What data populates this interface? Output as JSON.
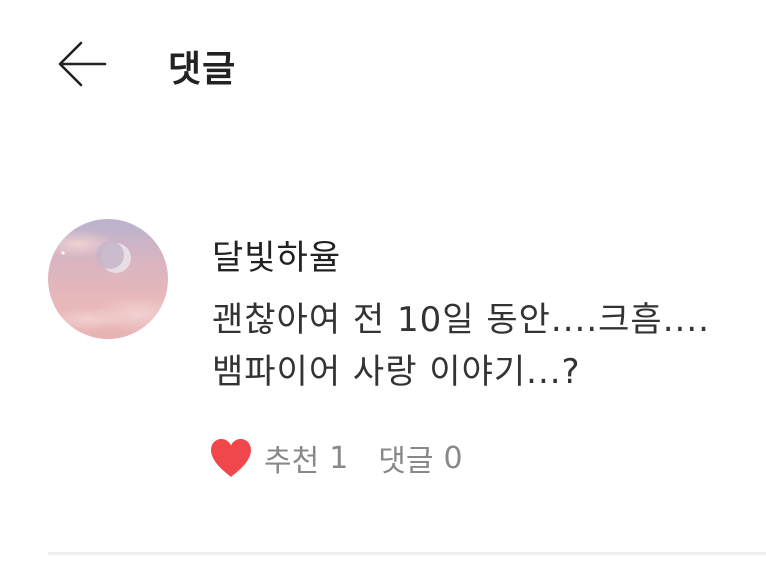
{
  "header": {
    "back_icon": "arrow-left-icon",
    "title": "댓글"
  },
  "comment": {
    "avatar_icon": "moon-avatar",
    "author": "달빛하율",
    "text_lines": [
      "괜찮아여 전 10일 동안....크흠....",
      "뱀파이어 사랑 이야기...?"
    ],
    "heart_icon": "heart-icon",
    "heart_color": "#f0474d",
    "like_label": "추천",
    "like_count": "1",
    "reply_label": "댓글",
    "reply_count": "0"
  }
}
